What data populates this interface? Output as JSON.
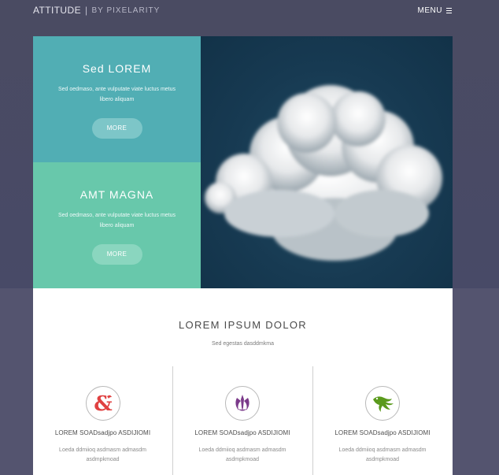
{
  "header": {
    "brand_name": "ATTITUDE",
    "brand_sep": "|",
    "brand_by": "BY PIXELARITY",
    "menu_label": "MENU"
  },
  "panels": [
    {
      "title": "Sed LOREM",
      "text_line1": "Sed oedmaso, ante vulputate viate luctus metus",
      "text_line2": "libero aliquam",
      "button": "MORE"
    },
    {
      "title": "AMT MAGNA",
      "text_line1": "Sed oedmaso, ante vulputate viate luctus metus",
      "text_line2": "libero aliquam",
      "button": "MORE"
    }
  ],
  "section": {
    "heading": "LOREM IPSUM DOLOR",
    "subheading": "Sed egestas dasddmkma"
  },
  "features": [
    {
      "icon": "ampersand-dragon-icon",
      "title": "LOREM SOADsadjpo ASDIJIOMI",
      "text_line1": "Loeda ddmiioq asdmasm admasdm",
      "text_line2": "asdmpkmoad"
    },
    {
      "icon": "jedi-order-icon",
      "title": "LOREM SOADsadjpo ASDIJIOMI",
      "text_line1": "Loeda ddmiioq asdmasm admasdm",
      "text_line2": "asdmpkmoad"
    },
    {
      "icon": "winged-creature-icon",
      "title": "LOREM SOADsadjpo ASDIJIOMI",
      "text_line1": "Loeda ddmiioq asdmasm admasdm",
      "text_line2": "asdmpkmoad"
    }
  ],
  "colors": {
    "panel1": "#51aeb4",
    "panel2": "#68c8ab",
    "icon_red": "#e04141",
    "icon_purple": "#7b3a8a",
    "icon_green": "#5a9a1c"
  }
}
